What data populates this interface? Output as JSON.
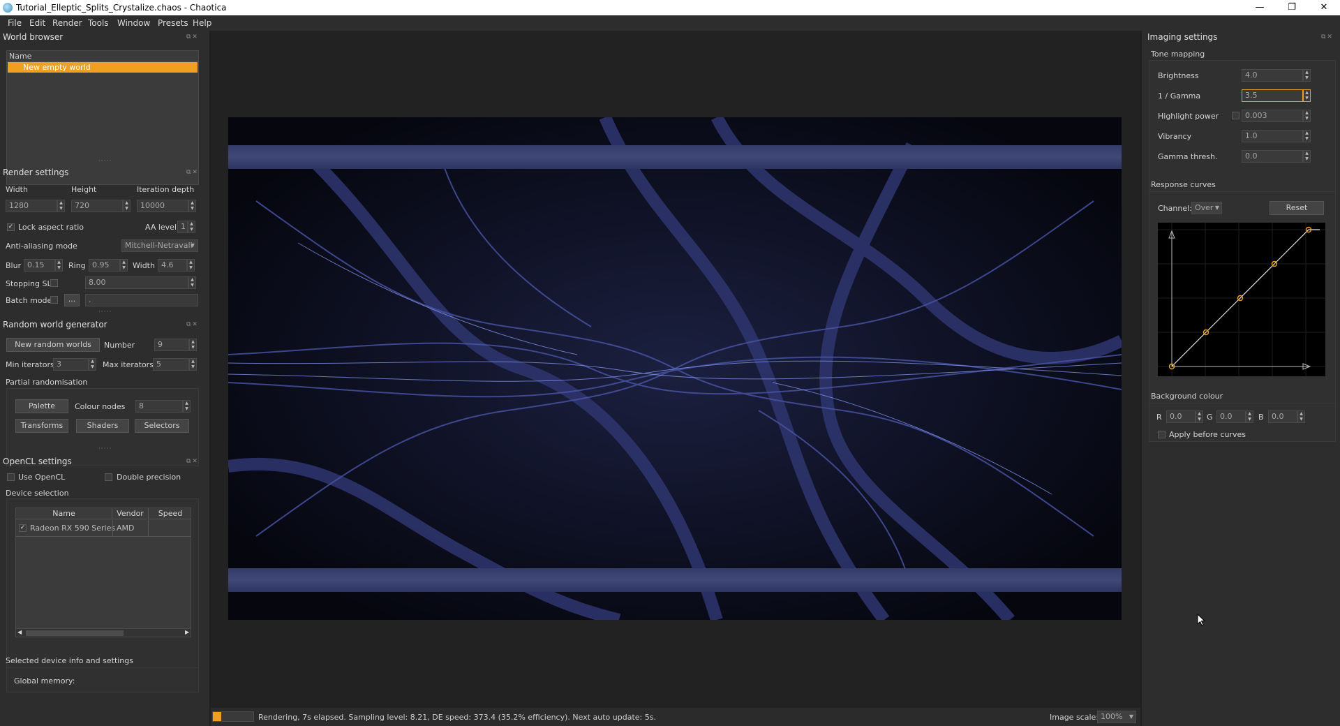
{
  "window": {
    "title": "Tutorial_Elleptic_Splits_Crystalize.chaos - Chaotica",
    "controls": {
      "minimize": "—",
      "restore": "❐",
      "close": "✕"
    }
  },
  "menu": [
    "File",
    "Edit",
    "Render",
    "Tools",
    "Window",
    "Presets",
    "Help"
  ],
  "world_browser": {
    "title": "World browser",
    "column": "Name",
    "items": [
      "New empty world"
    ]
  },
  "render_settings": {
    "title": "Render settings",
    "width_label": "Width",
    "height_label": "Height",
    "iter_label": "Iteration depth",
    "width": "1280",
    "height": "720",
    "iteration_depth": "10000",
    "lock_aspect": "Lock aspect ratio",
    "lock_checked": "✓",
    "aa_level_label": "AA level",
    "aa_level": "1",
    "aa_mode_label": "Anti-aliasing mode",
    "aa_mode": "Mitchell-Netravali",
    "blur_label": "Blur",
    "blur": "0.15",
    "ring_label": "Ring",
    "ring": "0.95",
    "width2_label": "Width",
    "width2": "4.6",
    "stopping_label": "Stopping SL",
    "stopping_value": "8.00",
    "batch_label": "Batch mode",
    "batch_button": "...",
    "batch_path": "."
  },
  "random_world": {
    "title": "Random world generator",
    "new_button": "New random worlds",
    "number_label": "Number",
    "number": "9",
    "min_label": "Min iterators",
    "min": "3",
    "max_label": "Max iterators",
    "max": "5",
    "partial_label": "Partial randomisation",
    "palette_button": "Palette",
    "colour_nodes_label": "Colour nodes",
    "colour_nodes": "8",
    "transforms_button": "Transforms",
    "shaders_button": "Shaders",
    "selectors_button": "Selectors"
  },
  "opencl": {
    "title": "OpenCL settings",
    "use_label": "Use OpenCL",
    "double_label": "Double precision",
    "device_selection": "Device selection",
    "columns": [
      "Name",
      "Vendor",
      "Speed"
    ],
    "devices": [
      {
        "name": "Radeon RX 590 Series",
        "vendor": "AMD",
        "speed": "",
        "checked": "✓"
      }
    ],
    "info_label": "Selected device info and settings",
    "global_memory": "Global memory:"
  },
  "imaging": {
    "title": "Imaging settings",
    "tone_mapping": "Tone mapping",
    "brightness_label": "Brightness",
    "brightness": "4.0",
    "gamma_label": "1 / Gamma",
    "gamma": "3.5",
    "highlight_label": "Highlight power",
    "highlight": "0.003",
    "vibrancy_label": "Vibrancy",
    "vibrancy": "1.0",
    "gamma_thresh_label": "Gamma thresh.",
    "gamma_thresh": "0.0",
    "response_curves": "Response curves",
    "channel_label": "Channel:",
    "channel": "Over",
    "reset_button": "Reset",
    "curve_points": [
      [
        0,
        0
      ],
      [
        0.25,
        0.25
      ],
      [
        0.5,
        0.5
      ],
      [
        0.75,
        0.75
      ],
      [
        1,
        1
      ]
    ],
    "background_colour": "Background colour",
    "r_label": "R",
    "r": "0.0",
    "g_label": "G",
    "g": "0.0",
    "b_label": "B",
    "b": "0.0",
    "apply_before_curves": "Apply before curves"
  },
  "status": {
    "message": "Rendering, 7s elapsed. Sampling level: 8.21, DE speed: 373.4 (35.2% efficiency). Next auto update: 5s.",
    "progress": 0.2,
    "image_scale_label": "Image scale:",
    "image_scale": "100%"
  },
  "colors": {
    "accent": "#f0a020",
    "render_band": "#3c4474",
    "render_bg": "#0a0c18",
    "filament": "#5b66b8"
  }
}
